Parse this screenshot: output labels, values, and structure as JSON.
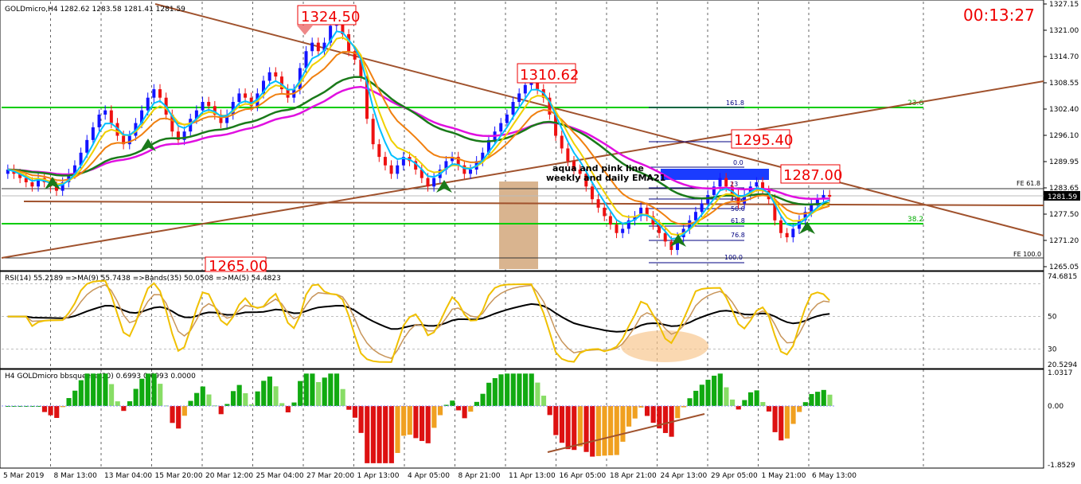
{
  "window": {
    "title": "GOLDmicro,H4  1282.62 1283.58 1281.41 1281.59",
    "timer": "00:13:27"
  },
  "colors": {
    "bull": "#1414ff",
    "bear": "#ee1111",
    "ma_aqua": "#00bfff",
    "ma_pink": "#e010e0",
    "ma_orange": "#f08010",
    "ma_yellow": "#f0d000",
    "ma_green": "#1a7a1a",
    "trend": "#a0522d",
    "hline": "#00cc00",
    "price_label": "#ee0000",
    "rsi_main": "#f0c000",
    "rsi_ma": "#c8955a",
    "rsi_band": "#000000",
    "sq_up_strong": "#11aa11",
    "sq_up_weak": "#88dd66",
    "sq_dn_strong": "#dd1111",
    "sq_dn_weak": "#f0a020"
  },
  "main_chart": {
    "price_axis": [
      "1327.15",
      "1321.00",
      "1314.70",
      "1308.55",
      "1302.40",
      "1296.10",
      "1289.95",
      "1283.65",
      "1277.50",
      "1271.20",
      "1265.05"
    ],
    "current_price": "1281.59",
    "price_labels": [
      "1324.50",
      "1310.62",
      "1295.40",
      "1287.00",
      "1265.00"
    ],
    "fib_labels": [
      "161.8",
      "127",
      "0.0",
      "23",
      "38.2",
      "50.0",
      "61.8",
      "76.8",
      "100.0"
    ],
    "fe_labels": [
      "FE 61.8",
      "FE 100.0"
    ],
    "hline_labels": [
      "23.6",
      "38.2"
    ],
    "annotation_line1": "aqua and pink line",
    "annotation_line2": "weekly and daily EMA21"
  },
  "rsi_panel": {
    "header": "RSI(14) 55.2189  =>MA(9) 55.7438  =>Bands(35) 50.0508  =>MA(5) 54.4823",
    "axis": [
      "74.6815",
      "50",
      "30",
      "20.5294"
    ]
  },
  "squeeze_panel": {
    "header": "H4 GOLDmicro bbsqueeze(20) 0.6993 0.6993 0.0000",
    "axis": [
      "1.0317",
      "0.00",
      "-1.8529"
    ]
  },
  "time_axis": [
    "5 Mar 2019",
    "8 Mar 13:00",
    "13 Mar 04:00",
    "15 Mar 20:00",
    "20 Mar 12:00",
    "25 Mar 04:00",
    "27 Mar 20:00",
    "1 Apr 13:00",
    "4 Apr 05:00",
    "8 Apr 21:00",
    "11 Apr 13:00",
    "16 Apr 05:00",
    "18 Apr 21:00",
    "24 Apr 13:00",
    "29 Apr 05:00",
    "1 May 21:00",
    "6 May 13:00"
  ],
  "chart_data": {
    "type": "candlestick",
    "symbol": "GOLDmicro",
    "timeframe": "H4",
    "ylim": [
      1265.05,
      1327.15
    ],
    "closes": [
      1288,
      1287,
      1286,
      1285,
      1284,
      1286,
      1285,
      1284,
      1283,
      1285,
      1287,
      1289,
      1292,
      1295,
      1298,
      1301,
      1302,
      1299,
      1296,
      1294,
      1296,
      1299,
      1302,
      1305,
      1307,
      1305,
      1301,
      1297,
      1295,
      1297,
      1300,
      1302,
      1304,
      1303,
      1301,
      1299,
      1301,
      1304,
      1306,
      1305,
      1303,
      1306,
      1309,
      1311,
      1310,
      1307,
      1305,
      1307,
      1312,
      1316,
      1318,
      1316,
      1318,
      1322,
      1324,
      1320,
      1316,
      1314,
      1310,
      1300,
      1294,
      1291,
      1289,
      1287,
      1289,
      1291,
      1290,
      1288,
      1286,
      1284,
      1286,
      1288,
      1290,
      1291,
      1289,
      1287,
      1288,
      1290,
      1292,
      1295,
      1297,
      1299,
      1301,
      1304,
      1306,
      1308,
      1310,
      1307,
      1305,
      1301,
      1296,
      1293,
      1290,
      1288,
      1287,
      1284,
      1281,
      1279,
      1277,
      1275,
      1273,
      1274,
      1276,
      1277,
      1279,
      1277,
      1275,
      1273,
      1271,
      1269,
      1272,
      1274,
      1276,
      1278,
      1280,
      1282,
      1284,
      1286,
      1284,
      1282,
      1280,
      1282,
      1284,
      1285,
      1283,
      1281,
      1276,
      1273,
      1272,
      1274,
      1276,
      1278,
      1280,
      1281,
      1282,
      1281.59
    ]
  }
}
